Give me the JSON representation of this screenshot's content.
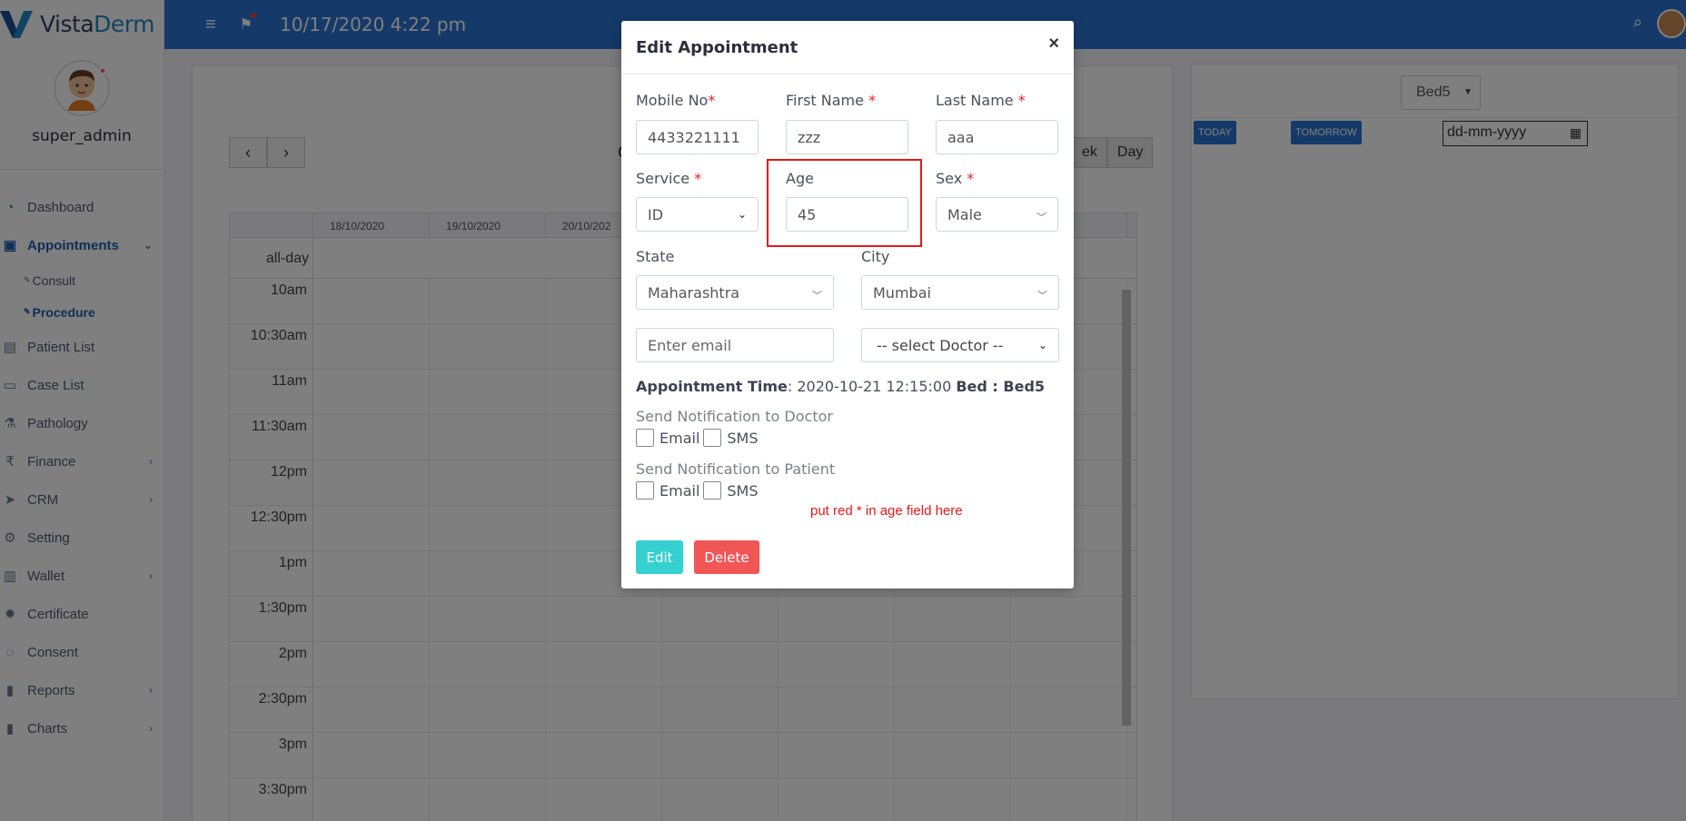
{
  "sidebar": {
    "brand": {
      "part1": "Vista",
      "part2": "Derm"
    },
    "username": "super_admin",
    "items": [
      {
        "label": "Dashboard"
      },
      {
        "label": "Appointments"
      },
      {
        "label": "Consult"
      },
      {
        "label": "Procedure"
      },
      {
        "label": "Patient List"
      },
      {
        "label": "Case List"
      },
      {
        "label": "Pathology"
      },
      {
        "label": "Finance"
      },
      {
        "label": "CRM"
      },
      {
        "label": "Setting"
      },
      {
        "label": "Wallet"
      },
      {
        "label": "Certificate"
      },
      {
        "label": "Consent"
      },
      {
        "label": "Reports"
      },
      {
        "label": "Charts"
      }
    ]
  },
  "topbar": {
    "datetime": "10/17/2020 4:22 pm"
  },
  "calendar": {
    "title": "OC",
    "views": [
      "ek",
      "Day"
    ],
    "days": [
      "18/10/2020",
      "19/10/2020",
      "20/10/202",
      "",
      "",
      "",
      "2020"
    ],
    "allday": "all-day",
    "times": [
      "10am",
      "10:30am",
      "11am",
      "11:30am",
      "12pm",
      "12:30pm",
      "1pm",
      "1:30pm",
      "2pm",
      "2:30pm",
      "3pm",
      "3:30pm"
    ]
  },
  "right_panel": {
    "bed": "Bed5",
    "today": "TODAY",
    "tomorrow": "TOMORROW",
    "date_placeholder": "dd-mm-yyyy"
  },
  "modal": {
    "title": "Edit Appointment",
    "close": "×",
    "mobile": {
      "label": "Mobile No",
      "required": "*",
      "value": "4433221111"
    },
    "first_name": {
      "label": "First Name",
      "required": "*",
      "value": "zzz"
    },
    "last_name": {
      "label": "Last Name",
      "required": "*",
      "value": "aaa"
    },
    "service": {
      "label": "Service",
      "required": "*",
      "value": "ID"
    },
    "age": {
      "label": "Age",
      "value": "45"
    },
    "sex": {
      "label": "Sex",
      "required": "*",
      "value": "Male"
    },
    "state": {
      "label": "State",
      "value": "Maharashtra"
    },
    "city": {
      "label": "City",
      "value": "Mumbai"
    },
    "email": {
      "placeholder": "Enter email"
    },
    "doctor": {
      "value": "-- select Doctor --"
    },
    "appointment_time": {
      "label": "Appointment Time",
      "value": ": 2020-10-21 12:15:00",
      "bed_label": "Bed : Bed5"
    },
    "notify_doctor": {
      "label": "Send Notification to Doctor",
      "email": "Email",
      "sms": "SMS"
    },
    "notify_patient": {
      "label": "Send Notification to Patient",
      "email": "Email",
      "sms": "SMS"
    },
    "annotation_note": "put red * in age field here",
    "edit_button": "Edit",
    "delete_button": "Delete"
  },
  "colors": {
    "topbar": "#2a74d2",
    "active_nav": "#1f5fae",
    "edit_button": "#35d1d1",
    "delete_button": "#f05656",
    "annotation": "#e01b1b"
  }
}
